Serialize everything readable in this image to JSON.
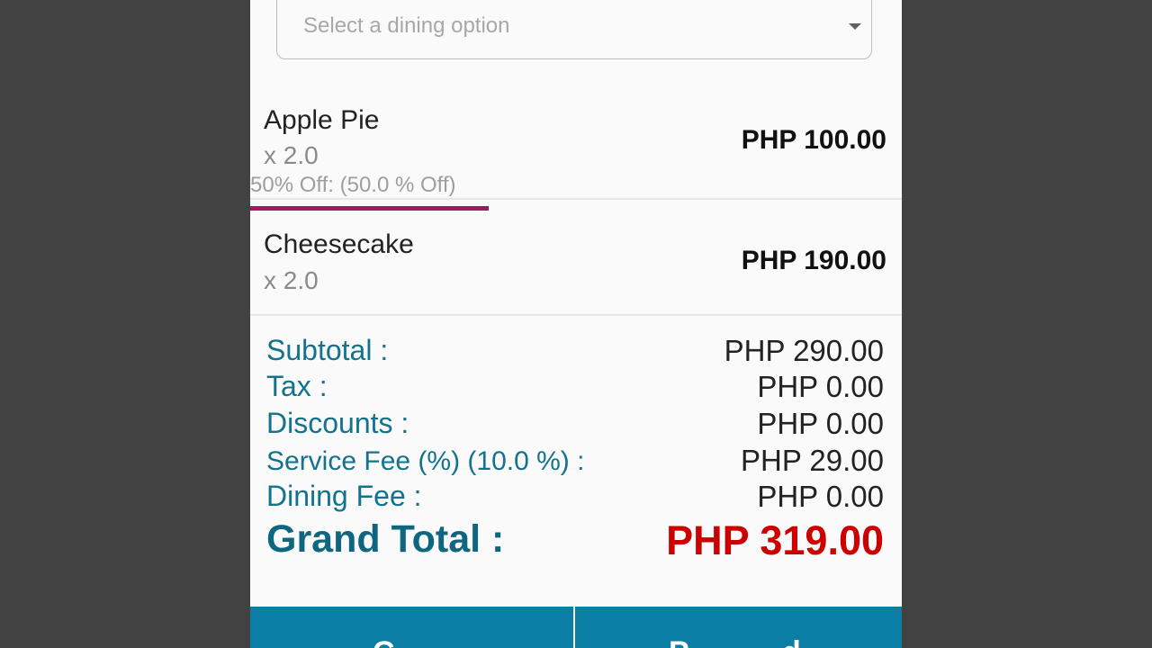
{
  "dining": {
    "placeholder": "Select a dining option"
  },
  "items": [
    {
      "name": "Apple Pie",
      "qty": "x 2.0",
      "price": "PHP 100.00",
      "discount": "50% Off:  (50.0 % Off)"
    },
    {
      "name": "Cheesecake",
      "qty": "x 2.0",
      "price": "PHP 190.00"
    }
  ],
  "summary": {
    "subtotal_label": "Subtotal :",
    "subtotal": "PHP 290.00",
    "tax_label": "Tax :",
    "tax": "PHP 0.00",
    "discounts_label": "Discounts :",
    "discounts": "PHP 0.00",
    "service_fee_label": "Service Fee (%) (10.0 %) :",
    "service_fee": "PHP 29.00",
    "dining_fee_label": "Dining Fee :",
    "dining_fee": "PHP 0.00",
    "grand_total_label": "Grand Total :",
    "grand_total": "PHP 319.00"
  },
  "buttons": {
    "left_partial": "C",
    "right_partial": "P           d"
  },
  "colors": {
    "accent": "#13738d",
    "total": "#cc0000",
    "button": "#0a7ea4",
    "highlight": "#a11a5e"
  }
}
